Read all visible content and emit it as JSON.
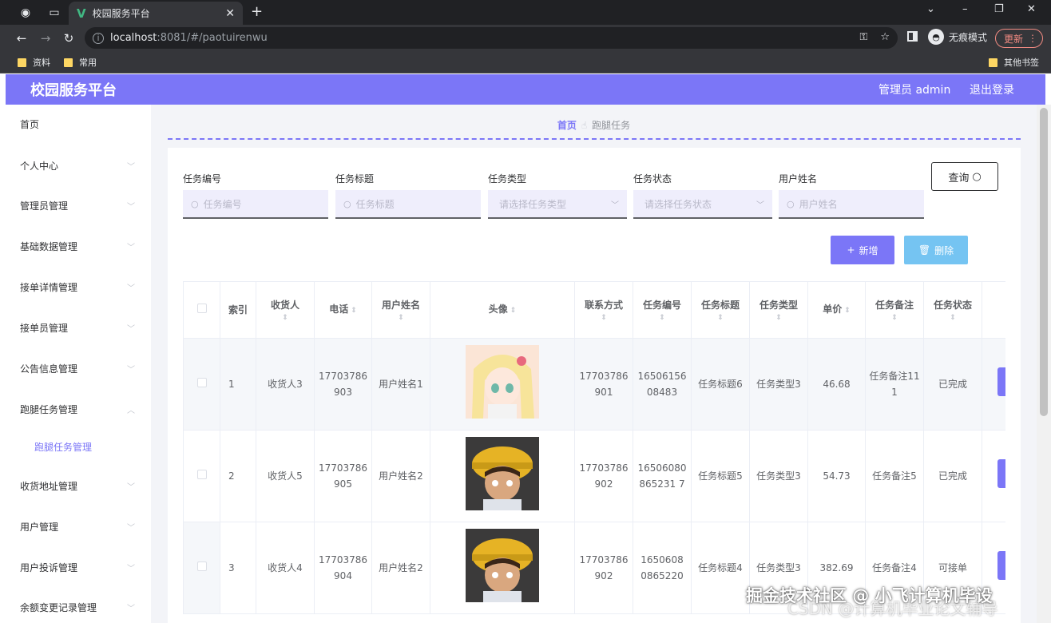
{
  "browser": {
    "tab_title": "校园服务平台",
    "url_host": "localhost",
    "url_path": ":8081/#/paotuirenwu",
    "incognito_label": "无痕模式",
    "update_label": "更新",
    "bookmarks": [
      "资料",
      "常用"
    ],
    "other_bookmarks": "其他书签"
  },
  "header": {
    "title": "校园服务平台",
    "user_label": "管理员 admin",
    "logout_label": "退出登录"
  },
  "sidebar": {
    "items": [
      {
        "label": "首页"
      },
      {
        "label": "个人中心"
      },
      {
        "label": "管理员管理"
      },
      {
        "label": "基础数据管理"
      },
      {
        "label": "接单详情管理"
      },
      {
        "label": "接单员管理"
      },
      {
        "label": "公告信息管理"
      },
      {
        "label": "跑腿任务管理"
      },
      {
        "label": "跑腿任务管理"
      },
      {
        "label": "收货地址管理"
      },
      {
        "label": "用户管理"
      },
      {
        "label": "用户投诉管理"
      },
      {
        "label": "余额变更记录管理"
      }
    ]
  },
  "breadcrumb": {
    "home": "首页",
    "current": "跑腿任务"
  },
  "filters": {
    "task_no": {
      "label": "任务编号",
      "placeholder": "任务编号"
    },
    "task_title": {
      "label": "任务标题",
      "placeholder": "任务标题"
    },
    "task_type": {
      "label": "任务类型",
      "placeholder": "请选择任务类型"
    },
    "task_status": {
      "label": "任务状态",
      "placeholder": "请选择任务状态"
    },
    "user_name": {
      "label": "用户姓名",
      "placeholder": "用户姓名"
    },
    "query_label": "查询"
  },
  "actions": {
    "add_label": "新增",
    "delete_label": "删除"
  },
  "table": {
    "columns": [
      "索引",
      "收货人",
      "电话",
      "用户姓名",
      "头像",
      "联系方式",
      "任务编号",
      "任务标题",
      "任务类型",
      "单价",
      "任务备注",
      "任务状态"
    ],
    "rows": [
      {
        "index": "1",
        "receiver": "收货人3",
        "phone": "17703786903",
        "user": "用户姓名1",
        "contact": "17703786901",
        "task_no": "1650615608483",
        "title": "任务标题6",
        "type": "任务类型3",
        "price": "46.68",
        "remark": "任务备注111",
        "status": "已完成"
      },
      {
        "index": "2",
        "receiver": "收货人5",
        "phone": "17703786905",
        "user": "用户姓名2",
        "contact": "17703786902",
        "task_no": "16506080865231 7",
        "title": "任务标题5",
        "type": "任务类型3",
        "price": "54.73",
        "remark": "任务备注5",
        "status": "已完成"
      },
      {
        "index": "3",
        "receiver": "收货人4",
        "phone": "17703786904",
        "user": "用户姓名2",
        "contact": "17703786902",
        "task_no": "1650608 0865220",
        "title": "任务标题4",
        "type": "任务类型3",
        "price": "382.69",
        "remark": "任务备注4",
        "status": "可接单"
      }
    ]
  },
  "watermark": {
    "line1": "掘金技术社区 @ 小飞计算机毕设",
    "line2": "CSDN @计算机毕业论文辅导"
  },
  "colors": {
    "accent": "#7b76f7",
    "delete": "#75c4f2",
    "header": "#7b76f7"
  }
}
